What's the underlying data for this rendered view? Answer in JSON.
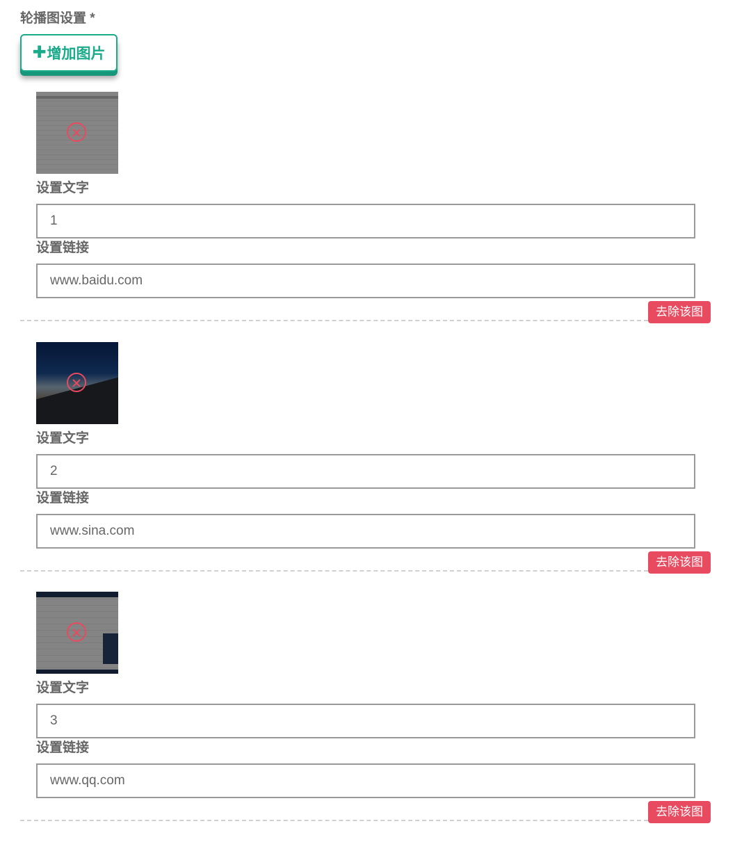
{
  "section": {
    "title": "轮播图设置 *"
  },
  "add_button": {
    "icon": "plus-icon",
    "label": "增加图片"
  },
  "colors": {
    "accent": "#1aab8a",
    "danger": "#e84a5f",
    "text": "#666666",
    "input_border": "#999999",
    "divider": "#d0d0d0"
  },
  "items": [
    {
      "thumbnail_icon": "delete-circle-icon",
      "text_label": "设置文字",
      "text_value": "1",
      "link_label": "设置链接",
      "link_value": "www.baidu.com",
      "remove_label": "去除该图"
    },
    {
      "thumbnail_icon": "delete-circle-icon",
      "text_label": "设置文字",
      "text_value": "2",
      "link_label": "设置链接",
      "link_value": "www.sina.com",
      "remove_label": "去除该图"
    },
    {
      "thumbnail_icon": "delete-circle-icon",
      "text_label": "设置文字",
      "text_value": "3",
      "link_label": "设置链接",
      "link_value": "www.qq.com",
      "remove_label": "去除该图"
    }
  ]
}
